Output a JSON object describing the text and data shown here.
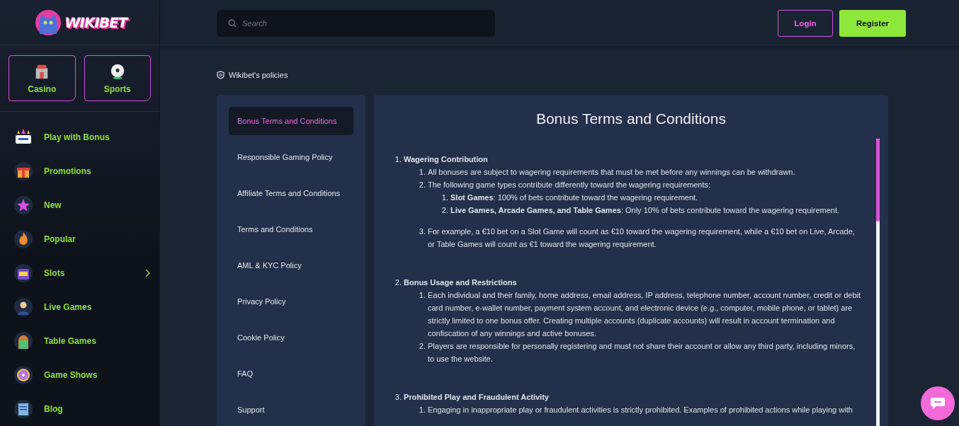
{
  "logo": {
    "text": "WIKIBET"
  },
  "search": {
    "placeholder": "Search"
  },
  "auth_buttons": [
    {
      "label": "Login",
      "kind": "outline"
    },
    {
      "label": "Register",
      "kind": "filled"
    }
  ],
  "category_tiles": [
    {
      "label": "Casino"
    },
    {
      "label": "Sports"
    }
  ],
  "sidebar": {
    "items": [
      {
        "label": "Play with Bonus",
        "expandable": false
      },
      {
        "label": "Promotions",
        "expandable": false
      },
      {
        "label": "New",
        "expandable": false
      },
      {
        "label": "Popular",
        "expandable": false
      },
      {
        "label": "Slots",
        "expandable": true
      },
      {
        "label": "Live Games",
        "expandable": false
      },
      {
        "label": "Table Games",
        "expandable": false
      },
      {
        "label": "Game Shows",
        "expandable": false
      },
      {
        "label": "Blog",
        "expandable": false
      }
    ]
  },
  "breadcrumb": "Wikibet's policies",
  "policy_nav": [
    {
      "label": "Bonus Terms and Conditions",
      "selected": true
    },
    {
      "label": "Responsible Gaming Policy",
      "selected": false
    },
    {
      "label": "Affiliate Terms and Conditions",
      "selected": false
    },
    {
      "label": "Terms and Conditions",
      "selected": false
    },
    {
      "label": "AML & KYC Policy",
      "selected": false
    },
    {
      "label": "Privacy Policy",
      "selected": false
    },
    {
      "label": "Cookie Policy",
      "selected": false
    },
    {
      "label": "FAQ",
      "selected": false
    },
    {
      "label": "Support",
      "selected": false
    }
  ],
  "document": {
    "title": "Bonus Terms and Conditions",
    "sections": [
      {
        "number": "1.",
        "title": "Wagering Contribution",
        "items": [
          {
            "number": "1.",
            "text": "All bonuses are subject to wagering requirements that must be met before any winnings can be withdrawn."
          },
          {
            "number": "2.",
            "text": "The following game types contribute differently toward the wagering requirements:",
            "children": [
              {
                "number": "1.",
                "text": "**Slot Games**: 100% of bets contribute toward the wagering requirement."
              },
              {
                "number": "2.",
                "text": "**Live Games, Arcade Games, and Table Games**: Only 10% of bets contribute toward the wagering requirement."
              }
            ]
          },
          {
            "number": "3.",
            "text": "For example, a €10 bet on a Slot Game will count as €10 toward the wagering requirement, while a €10 bet on Live, Arcade, or Table Games will count as €1 toward the wagering requirement."
          }
        ]
      },
      {
        "number": "2.",
        "title": "Bonus Usage and Restrictions",
        "items": [
          {
            "number": "1.",
            "text": "Each individual and their family, home address, email address, IP address, telephone number, account number, credit or debit card number, e-wallet number, payment system account, and electronic device (e.g., computer, mobile phone, or tablet) are strictly limited to one bonus offer. Creating multiple accounts (duplicate accounts) will result in account termination and confiscation of any winnings and active bonuses."
          },
          {
            "number": "2.",
            "text": "Players are responsible for personally registering and must not share their account or allow any third party, including minors, to use the website."
          }
        ]
      },
      {
        "number": "3.",
        "title": "Prohibited Play and Fraudulent Activity",
        "items": [
          {
            "number": "1.",
            "text": "Engaging in inappropriate play or fraudulent activities is strictly prohibited. Examples of prohibited actions while playing with"
          }
        ]
      }
    ]
  }
}
